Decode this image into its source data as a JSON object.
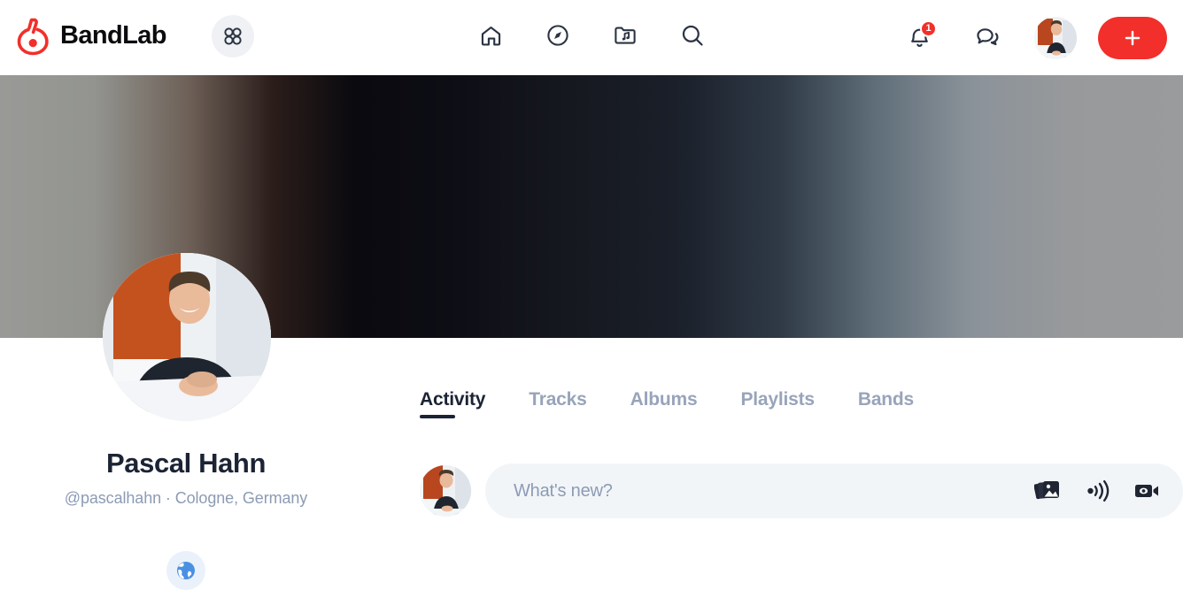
{
  "brand": {
    "name": "BandLab",
    "logo_icon": "bandlab-logo-icon",
    "accent_color": "#f22f2a"
  },
  "header": {
    "apps_icon": "grid-apps-icon",
    "nav": [
      {
        "name": "home",
        "icon": "home-icon"
      },
      {
        "name": "explore",
        "icon": "compass-icon"
      },
      {
        "name": "library",
        "icon": "music-folder-icon"
      },
      {
        "name": "search",
        "icon": "search-icon"
      }
    ],
    "notifications": {
      "icon": "bell-icon",
      "badge_count": "1",
      "badge_color": "#f22f2a"
    },
    "messages": {
      "icon": "chat-bubbles-icon"
    },
    "account_avatar": "user-avatar",
    "create_button": {
      "icon": "plus-icon",
      "label": "+"
    }
  },
  "profile": {
    "avatar": "profile-photo",
    "name": "Pascal Hahn",
    "meta": "@pascalhahn · Cologne, Germany",
    "handle": "@pascalhahn",
    "location": "Cologne, Germany",
    "links": [
      {
        "name": "website",
        "icon": "globe-icon",
        "glyph": "🌎"
      }
    ]
  },
  "tabs": [
    {
      "label": "Activity",
      "active": true
    },
    {
      "label": "Tracks",
      "active": false
    },
    {
      "label": "Albums",
      "active": false
    },
    {
      "label": "Playlists",
      "active": false
    },
    {
      "label": "Bands",
      "active": false
    }
  ],
  "composer": {
    "avatar": "user-avatar",
    "placeholder": "What's new?",
    "value": "",
    "actions": [
      {
        "name": "add-image",
        "icon": "photo-stack-icon"
      },
      {
        "name": "add-audio",
        "icon": "live-audio-icon"
      },
      {
        "name": "add-video",
        "icon": "video-camera-icon"
      }
    ]
  },
  "colors": {
    "text_primary": "#1b2334",
    "text_muted": "#8c9bb5",
    "surface": "#f2f5f8",
    "accent": "#f22f2a"
  }
}
